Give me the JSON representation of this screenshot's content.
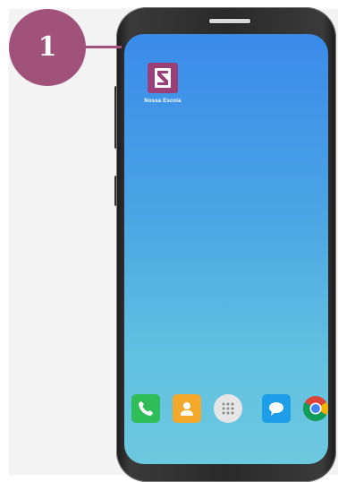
{
  "callout": {
    "step_number": "1",
    "color": "#a0527a"
  },
  "home_screen": {
    "app": {
      "label": "Nossa Escola",
      "icon": "school-app-icon",
      "color": "#9a3f78"
    }
  },
  "dock": [
    {
      "icon": "phone-icon",
      "color": "#2fbd58"
    },
    {
      "icon": "contacts-icon",
      "color": "#f2a82a"
    },
    {
      "icon": "app-drawer-icon",
      "color": "#e6e6e6"
    },
    {
      "icon": "messages-icon",
      "color": "#1e9de8"
    },
    {
      "icon": "chrome-icon",
      "color": "#ffffff"
    }
  ]
}
